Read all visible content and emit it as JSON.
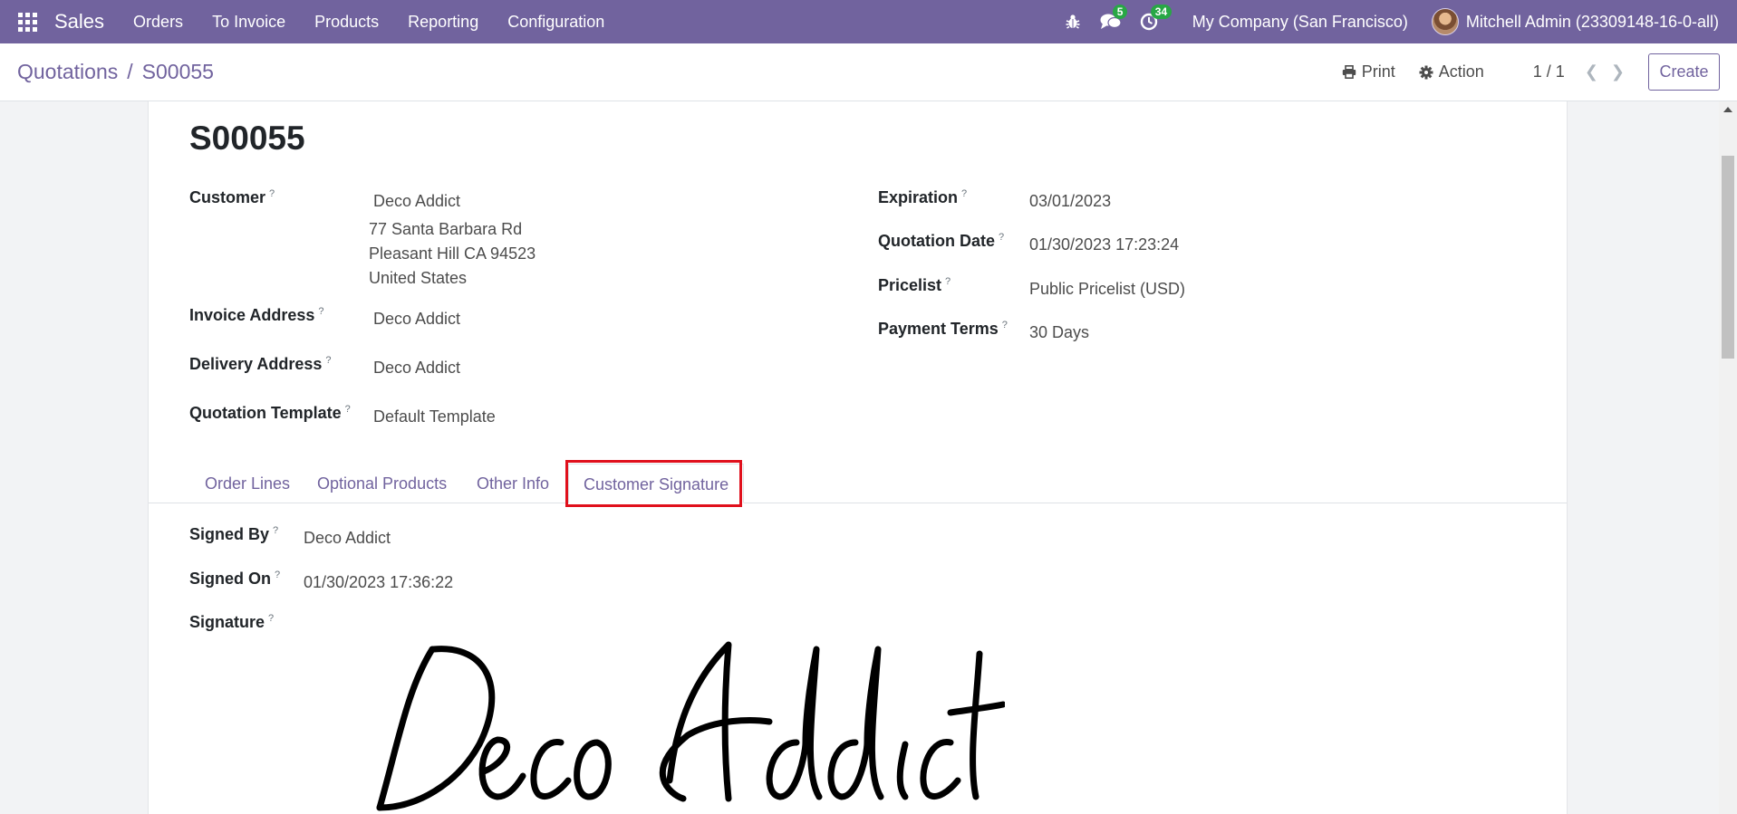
{
  "navbar": {
    "brand": "Sales",
    "menu": [
      "Orders",
      "To Invoice",
      "Products",
      "Reporting",
      "Configuration"
    ],
    "messages_count": "5",
    "activities_count": "34",
    "company": "My Company (San Francisco)",
    "user": "Mitchell Admin (23309148-16-0-all)"
  },
  "control_panel": {
    "breadcrumb_parent": "Quotations",
    "breadcrumb_sep": "/",
    "breadcrumb_current": "S00055",
    "print_label": "Print",
    "action_label": "Action",
    "pager": "1 / 1",
    "create_label": "Create"
  },
  "record": {
    "name": "S00055",
    "help_mark": "?",
    "left_fields": {
      "customer_label": "Customer",
      "customer_name": "Deco Addict",
      "address_line1": "77 Santa Barbara Rd",
      "address_line2": "Pleasant Hill CA 94523",
      "address_line3": "United States",
      "invoice_address_label": "Invoice Address",
      "invoice_address": "Deco Addict",
      "delivery_address_label": "Delivery Address",
      "delivery_address": "Deco Addict",
      "quotation_template_label": "Quotation Template",
      "quotation_template": "Default Template"
    },
    "right_fields": {
      "expiration_label": "Expiration",
      "expiration": "03/01/2023",
      "quotation_date_label": "Quotation Date",
      "quotation_date": "01/30/2023 17:23:24",
      "pricelist_label": "Pricelist",
      "pricelist": "Public Pricelist (USD)",
      "payment_terms_label": "Payment Terms",
      "payment_terms": "30 Days"
    }
  },
  "tabs": [
    "Order Lines",
    "Optional Products",
    "Other Info",
    "Customer Signature"
  ],
  "signature_tab": {
    "signed_by_label": "Signed By",
    "signed_by": "Deco Addict",
    "signed_on_label": "Signed On",
    "signed_on": "01/30/2023 17:36:22",
    "signature_label": "Signature",
    "signature_text": "Deco Addict"
  },
  "colors": {
    "brand": "#71639e",
    "badge": "#28a745",
    "highlight": "#e0101c"
  }
}
